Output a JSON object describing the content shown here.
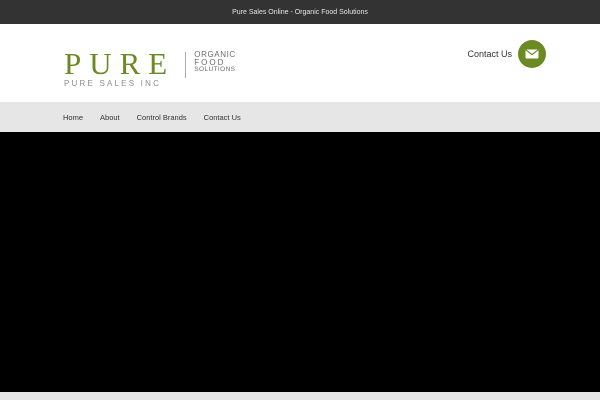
{
  "topbar": {
    "text": "Pure Sales Online - Organic Food Solutions"
  },
  "logo": {
    "word": "PURE",
    "sub": "PURE SALES INC",
    "tag_line1": "ORGANIC",
    "tag_line2": "FOOD",
    "tag_line3": "SOLUTIONS"
  },
  "contact": {
    "label": "Contact Us",
    "icon": "envelope-icon"
  },
  "nav": {
    "items": [
      {
        "label": "Home"
      },
      {
        "label": "About"
      },
      {
        "label": "Control Brands"
      },
      {
        "label": "Contact Us"
      }
    ]
  },
  "colors": {
    "brand_green": "#6b8a23",
    "topbar_bg": "#333333",
    "nav_bg": "#e6e6e6",
    "hero_bg": "#000000"
  }
}
